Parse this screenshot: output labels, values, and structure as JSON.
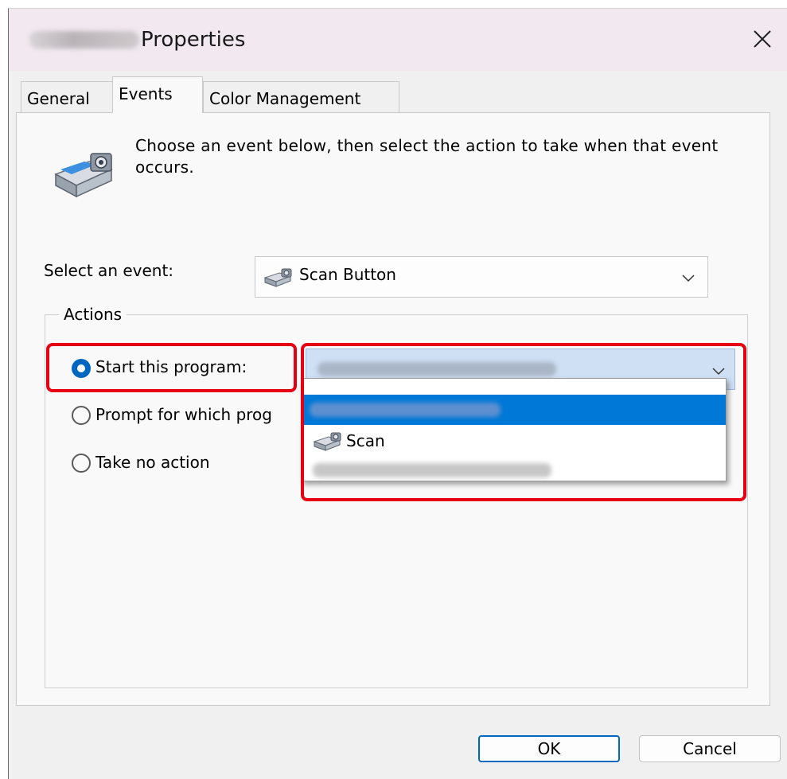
{
  "window": {
    "title": "Properties",
    "title_prefix_blurred": true,
    "close_icon": "close-icon"
  },
  "tabs": [
    {
      "label": "General",
      "active": false
    },
    {
      "label": "Events",
      "active": true
    },
    {
      "label": "Color Management",
      "active": false
    }
  ],
  "events_tab": {
    "description": "Choose an event below, then select the action to take when that event occurs.",
    "header_icon": "scanner-icon",
    "select_event_label": "Select an event:",
    "selected_event": "Scan Button",
    "actions_group_title": "Actions",
    "actions": [
      {
        "label": "Start this program:",
        "selected": true
      },
      {
        "label": "Prompt for which prog",
        "selected": false
      },
      {
        "label": "Take no action",
        "selected": false
      }
    ],
    "program_dropdown": {
      "current_value_blurred": true,
      "expanded": true,
      "options": [
        {
          "label": "",
          "blurred": true,
          "highlighted": true
        },
        {
          "label": "Scan",
          "blurred": false,
          "highlighted": false,
          "icon": "scanner-icon"
        },
        {
          "label": "",
          "blurred": true,
          "highlighted": false
        }
      ]
    }
  },
  "buttons": {
    "ok": "OK",
    "cancel": "Cancel"
  },
  "colors": {
    "accent": "#0067c0",
    "highlight": "#0078d7",
    "annotation_red": "#e60012"
  }
}
